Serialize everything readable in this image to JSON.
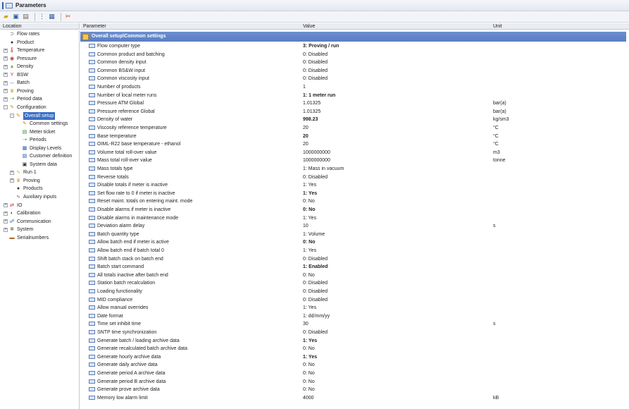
{
  "window": {
    "title": "Parameters"
  },
  "toolbar": {
    "icons": [
      "open-folder-icon",
      "save-icon",
      "print-icon",
      "tree-view-icon",
      "table-view-icon",
      "tools-icon"
    ]
  },
  "columns": {
    "location": "Location",
    "parameter": "Parameter",
    "value": "Value",
    "unit": "Unit"
  },
  "group_title": "Overall setup\\Common settings",
  "tree": [
    {
      "label": "Flow rates",
      "level": 0,
      "expander": "",
      "icon": "flow-icon"
    },
    {
      "label": "Product",
      "level": 0,
      "expander": "",
      "icon": "drop-icon"
    },
    {
      "label": "Temperature",
      "level": 0,
      "expander": "+",
      "icon": "thermometer-icon"
    },
    {
      "label": "Pressure",
      "level": 0,
      "expander": "+",
      "icon": "gauge-icon"
    },
    {
      "label": "Density",
      "level": 0,
      "expander": "+",
      "icon": "density-icon"
    },
    {
      "label": "BSW",
      "level": 0,
      "expander": "+",
      "icon": "bsw-icon"
    },
    {
      "label": "Batch",
      "level": 0,
      "expander": "+",
      "icon": "batch-icon"
    },
    {
      "label": "Proving",
      "level": 0,
      "expander": "+",
      "icon": "trophy-icon"
    },
    {
      "label": "Period data",
      "level": 0,
      "expander": "+",
      "icon": "period-icon"
    },
    {
      "label": "Configuration",
      "level": 0,
      "expander": "-",
      "icon": "wrench-icon"
    },
    {
      "label": "Overall setup",
      "level": 1,
      "expander": "-",
      "icon": "wrench-icon",
      "selected": true
    },
    {
      "label": "Common settings",
      "level": 2,
      "expander": "",
      "icon": "wrench-icon"
    },
    {
      "label": "Meter ticket",
      "level": 2,
      "expander": "",
      "icon": "ticket-icon"
    },
    {
      "label": "Periods",
      "level": 2,
      "expander": "",
      "icon": "period-icon"
    },
    {
      "label": "Display Levels",
      "level": 2,
      "expander": "",
      "icon": "display-icon"
    },
    {
      "label": "Customer definition",
      "level": 2,
      "expander": "",
      "icon": "customer-icon"
    },
    {
      "label": "System data",
      "level": 2,
      "expander": "",
      "icon": "system-data-icon"
    },
    {
      "label": "Run 1",
      "level": 1,
      "expander": "+",
      "icon": "run-icon"
    },
    {
      "label": "Proving",
      "level": 1,
      "expander": "+",
      "icon": "trophy-icon"
    },
    {
      "label": "Products",
      "level": 1,
      "expander": "",
      "icon": "drop-icon"
    },
    {
      "label": "Auxiliary inputs",
      "level": 1,
      "expander": "",
      "icon": "aux-icon"
    },
    {
      "label": "IO",
      "level": 0,
      "expander": "+",
      "icon": "io-icon"
    },
    {
      "label": "Calibration",
      "level": 0,
      "expander": "+",
      "icon": "calibration-icon"
    },
    {
      "label": "Communication",
      "level": 0,
      "expander": "+",
      "icon": "network-icon"
    },
    {
      "label": "System",
      "level": 0,
      "expander": "+",
      "icon": "gear-icon"
    },
    {
      "label": "Serialnumbers",
      "level": 0,
      "expander": "",
      "icon": "serial-icon"
    }
  ],
  "parameters": [
    {
      "name": "Flow computer type",
      "value": "3: Proving / run",
      "unit": "",
      "bold": true
    },
    {
      "name": "Common product and batching",
      "value": "0: Disabled",
      "unit": ""
    },
    {
      "name": "Common density input",
      "value": "0: Disabled",
      "unit": ""
    },
    {
      "name": "Common BS&W input",
      "value": "0: Disabled",
      "unit": ""
    },
    {
      "name": "Common viscosity input",
      "value": "0: Disabled",
      "unit": ""
    },
    {
      "name": "Number of products",
      "value": "1",
      "unit": ""
    },
    {
      "name": "Number of local meter runs",
      "value": "1: 1 meter run",
      "unit": "",
      "bold": true
    },
    {
      "name": "Pressure ATM Global",
      "value": "1.01325",
      "unit": "bar(a)"
    },
    {
      "name": "Pressure reference Global",
      "value": "1.01325",
      "unit": "bar(a)"
    },
    {
      "name": "Density of water",
      "value": "998.23",
      "unit": "kg/sm3",
      "bold": true
    },
    {
      "name": "Viscosity reference temperature",
      "value": "20",
      "unit": "°C"
    },
    {
      "name": "Base temperature",
      "value": "20",
      "unit": "°C",
      "bold": true
    },
    {
      "name": "OIML-R22 base temperature - ethanol",
      "value": "20",
      "unit": "°C"
    },
    {
      "name": "Volume total roll-over value",
      "value": "1000000000",
      "unit": "m3"
    },
    {
      "name": "Mass total roll-over value",
      "value": "1000000000",
      "unit": "tonne"
    },
    {
      "name": "Mass totals type",
      "value": "1: Mass in vacuum",
      "unit": ""
    },
    {
      "name": "Reverse totals",
      "value": "0: Disabled",
      "unit": ""
    },
    {
      "name": "Disable totals if meter is inactive",
      "value": "1: Yes",
      "unit": ""
    },
    {
      "name": "Set flow rate to 0 if meter is inactive",
      "value": "1: Yes",
      "unit": "",
      "bold": true
    },
    {
      "name": "Reset maint. totals on entering maint. mode",
      "value": "0: No",
      "unit": ""
    },
    {
      "name": "Disable alarms if meter is inactive",
      "value": "0: No",
      "unit": "",
      "bold": true
    },
    {
      "name": "Disable alarms in maintenance mode",
      "value": "1: Yes",
      "unit": ""
    },
    {
      "name": "Deviation alarm delay",
      "value": "10",
      "unit": "s"
    },
    {
      "name": "Batch quantity type",
      "value": "1: Volume",
      "unit": ""
    },
    {
      "name": "Allow batch end if meter is active",
      "value": "0: No",
      "unit": "",
      "bold": true
    },
    {
      "name": "Allow batch end if batch total 0",
      "value": "1: Yes",
      "unit": ""
    },
    {
      "name": "Shift batch stack on batch end",
      "value": "0: Disabled",
      "unit": ""
    },
    {
      "name": "Batch start command",
      "value": "1: Enabled",
      "unit": "",
      "bold": true
    },
    {
      "name": "All totals inactive after batch end",
      "value": "0: No",
      "unit": ""
    },
    {
      "name": "Station batch recalculation",
      "value": "0: Disabled",
      "unit": ""
    },
    {
      "name": "Loading functionality",
      "value": "0: Disabled",
      "unit": ""
    },
    {
      "name": "MID compliance",
      "value": "0: Disabled",
      "unit": ""
    },
    {
      "name": "Allow manual overrides",
      "value": "1: Yes",
      "unit": ""
    },
    {
      "name": "Date format",
      "value": "1: dd/mm/yy",
      "unit": ""
    },
    {
      "name": "Time set inhibit time",
      "value": "30",
      "unit": "s"
    },
    {
      "name": "SNTP time synchronization",
      "value": "0: Disabled",
      "unit": ""
    },
    {
      "name": "Generate batch / loading archive data",
      "value": "1: Yes",
      "unit": "",
      "bold": true
    },
    {
      "name": "Generate recalculated batch archive data",
      "value": "0: No",
      "unit": ""
    },
    {
      "name": "Generate hourly archive data",
      "value": "1: Yes",
      "unit": "",
      "bold": true
    },
    {
      "name": "Generate daily archive data",
      "value": "0: No",
      "unit": ""
    },
    {
      "name": "Generate period A archive data",
      "value": "0: No",
      "unit": ""
    },
    {
      "name": "Generate period B archive data",
      "value": "0: No",
      "unit": ""
    },
    {
      "name": "Generate prove archive data",
      "value": "0: No",
      "unit": ""
    },
    {
      "name": "Memory low alarm limit",
      "value": "4000",
      "unit": "kB"
    }
  ]
}
